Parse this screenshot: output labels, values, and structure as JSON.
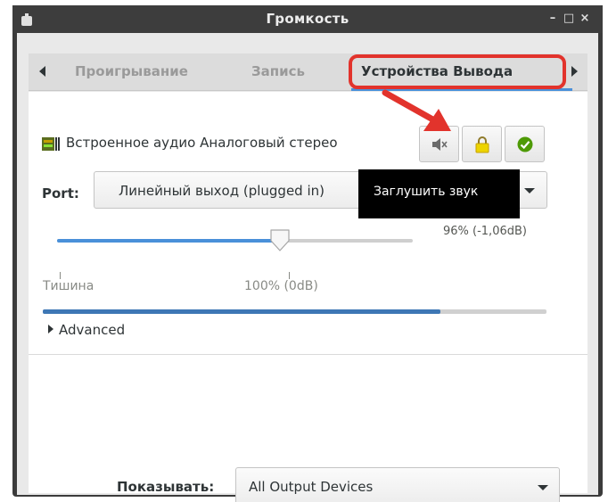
{
  "window": {
    "title": "Громкость",
    "minimize_glyph": "–",
    "maximize_glyph": "□",
    "close_glyph": "×"
  },
  "tabs": [
    {
      "label": "Проигрывание",
      "active": false
    },
    {
      "label": "Запись",
      "active": false
    },
    {
      "label": "Устройства Вывода",
      "active": true
    }
  ],
  "device": {
    "name": "Встроенное аудио Аналоговый стерео",
    "icon": "sound-card-icon",
    "buttons": [
      {
        "name": "mute-button",
        "icon": "speaker-muted-icon"
      },
      {
        "name": "lock-channels-button",
        "icon": "padlock-icon"
      },
      {
        "name": "set-default-button",
        "icon": "checkmark-icon"
      }
    ]
  },
  "port": {
    "label": "Port:",
    "value": "Линейный выход (plugged in)"
  },
  "tooltip": {
    "text": "Заглушить звук"
  },
  "volume": {
    "value_text": "96% (-1,06dB)",
    "fraction": 0.96,
    "tick_silence": "Тишина",
    "tick_100": "100% (0dB)"
  },
  "level_meter": {
    "fraction": 0.79
  },
  "advanced": {
    "label": "Advanced"
  },
  "show": {
    "label": "Показывать:",
    "value": "All Output Devices"
  },
  "colors": {
    "accent": "#4a90d9",
    "highlight": "#e2332c",
    "titlebar": "#3d3d3d",
    "tooltip_bg": "#000000"
  }
}
